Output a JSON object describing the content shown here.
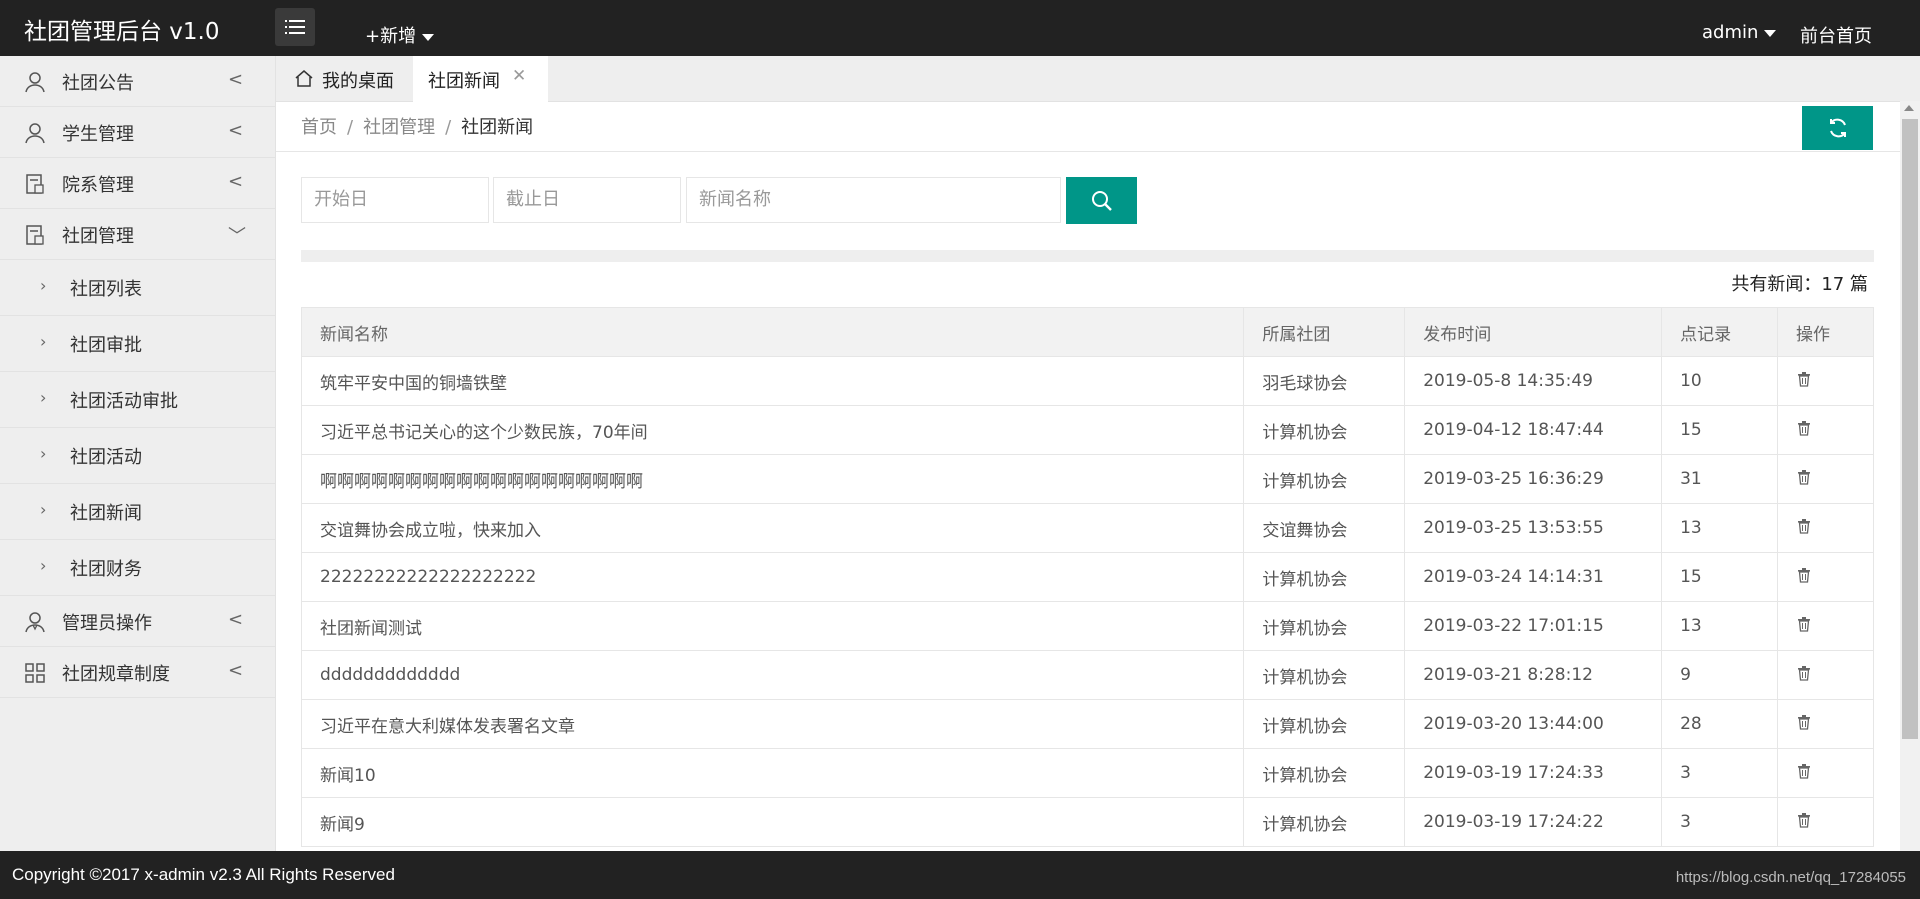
{
  "header": {
    "logo": "社团管理后台 v1.0",
    "add_new": "+新增",
    "user": "admin",
    "front_home": "前台首页"
  },
  "sidebar": {
    "items": [
      {
        "label": "社团公告",
        "icon": "user-icon",
        "arrow": "<"
      },
      {
        "label": "学生管理",
        "icon": "user-icon",
        "arrow": "<"
      },
      {
        "label": "院系管理",
        "icon": "document-icon",
        "arrow": "<"
      },
      {
        "label": "社团管理",
        "icon": "document-icon",
        "arrow": "﹀"
      }
    ],
    "sub_items": [
      "社团列表",
      "社团审批",
      "社团活动审批",
      "社团活动",
      "社团新闻",
      "社团财务"
    ],
    "items_after": [
      {
        "label": "管理员操作",
        "icon": "admin-user-icon",
        "arrow": "<"
      },
      {
        "label": "社团规章制度",
        "icon": "grid-icon",
        "arrow": "<"
      }
    ]
  },
  "tabs": {
    "home": "我的桌面",
    "active": "社团新闻"
  },
  "breadcrumb": {
    "home": "首页",
    "parent": "社团管理",
    "current": "社团新闻"
  },
  "search": {
    "start_placeholder": "开始日",
    "end_placeholder": "截止日",
    "name_placeholder": "新闻名称"
  },
  "total": "共有新闻：17 篇",
  "table": {
    "columns": [
      "新闻名称",
      "所属社团",
      "发布时间",
      "点记录",
      "操作"
    ],
    "rows": [
      {
        "name": "筑牢平安中国的铜墙铁壁",
        "club": "羽毛球协会",
        "time": "2019-05-8 14:35:49",
        "views": "10"
      },
      {
        "name": "习近平总书记关心的这个少数民族，70年间",
        "club": "计算机协会",
        "time": "2019-04-12 18:47:44",
        "views": "15"
      },
      {
        "name": "啊啊啊啊啊啊啊啊啊啊啊啊啊啊啊啊啊啊啊",
        "club": "计算机协会",
        "time": "2019-03-25 16:36:29",
        "views": "31"
      },
      {
        "name": "交谊舞协会成立啦，快来加入",
        "club": "交谊舞协会",
        "time": "2019-03-25 13:53:55",
        "views": "13"
      },
      {
        "name": "22222222222222222222",
        "club": "计算机协会",
        "time": "2019-03-24 14:14:31",
        "views": "15"
      },
      {
        "name": "社团新闻测试",
        "club": "计算机协会",
        "time": "2019-03-22 17:01:15",
        "views": "13"
      },
      {
        "name": "ddddddddddddd",
        "club": "计算机协会",
        "time": "2019-03-21 8:28:12",
        "views": "9"
      },
      {
        "name": "习近平在意大利媒体发表署名文章",
        "club": "计算机协会",
        "time": "2019-03-20 13:44:00",
        "views": "28"
      },
      {
        "name": "新闻10",
        "club": "计算机协会",
        "time": "2019-03-19 17:24:33",
        "views": "3"
      },
      {
        "name": "新闻9",
        "club": "计算机协会",
        "time": "2019-03-19 17:24:22",
        "views": "3"
      }
    ]
  },
  "footer": {
    "copyright": "Copyright ©2017 x-admin v2.3 All Rights Reserved",
    "watermark": "https://blog.csdn.net/qq_17284055"
  },
  "colors": {
    "accent": "#009688",
    "header_bg": "#222222",
    "sidebar_bg": "#eeeeee"
  }
}
